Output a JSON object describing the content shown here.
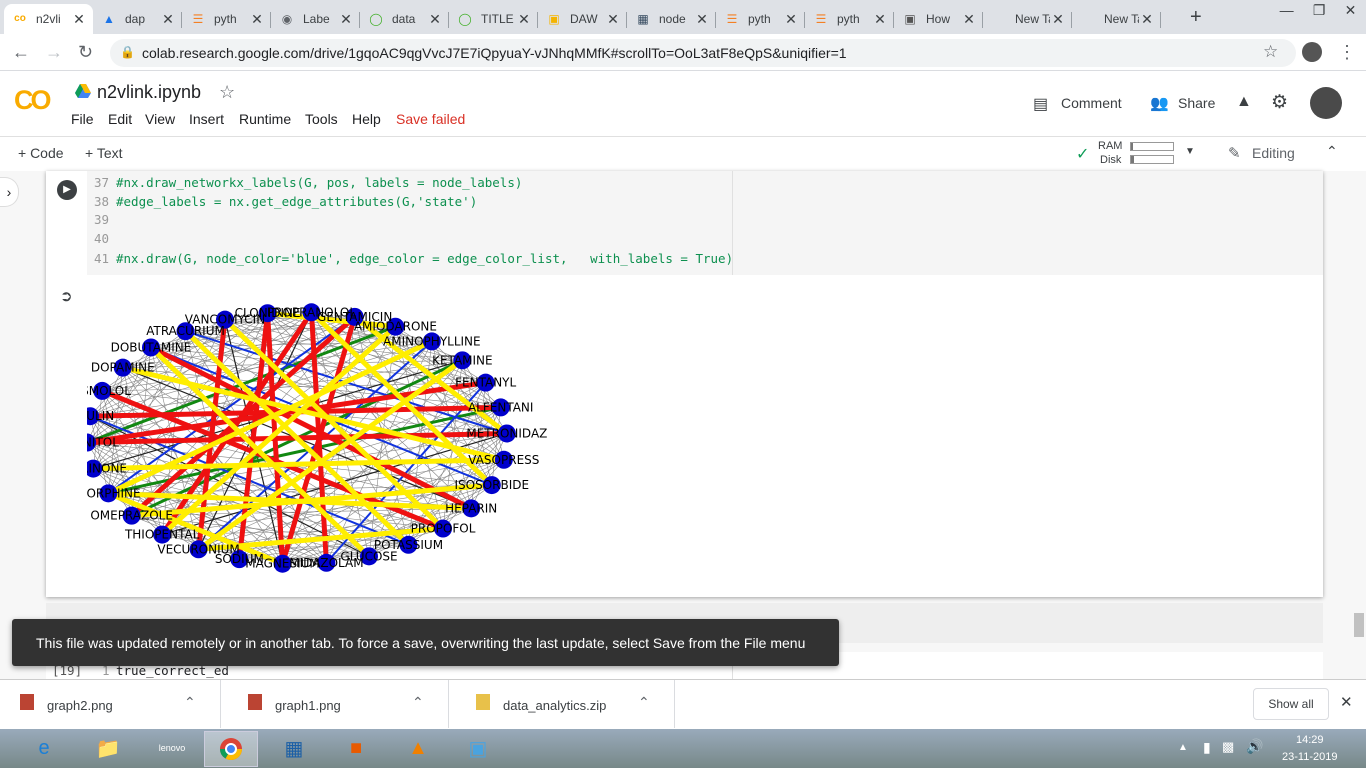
{
  "browser": {
    "tabs": [
      {
        "icon": "colab-icon",
        "label": "n2vli"
      },
      {
        "icon": "drive-icon",
        "label": "dap"
      },
      {
        "icon": "stackoverflow-icon",
        "label": "pyth"
      },
      {
        "icon": "globe-icon",
        "label": "Labe"
      },
      {
        "icon": "anaconda-icon",
        "label": "data"
      },
      {
        "icon": "anaconda-icon",
        "label": "TITLE"
      },
      {
        "icon": "slides-icon",
        "label": "DAW"
      },
      {
        "icon": "page-icon",
        "label": "node"
      },
      {
        "icon": "stackoverflow-icon",
        "label": "pyth"
      },
      {
        "icon": "stackoverflow-icon",
        "label": "pyth"
      },
      {
        "icon": "image-icon",
        "label": "How"
      },
      {
        "icon": "blank-icon",
        "label": "New Tab"
      },
      {
        "icon": "blank-icon",
        "label": "New Tab"
      }
    ],
    "url": "colab.research.google.com/drive/1gqoAC9qgVvcJ7E7iQpyuaY-vJNhqMMfK#scrollTo=OoL3atF8eQpS&uniqifier=1"
  },
  "colab": {
    "logo": "CO",
    "notebook_title": "n2vlink.ipynb",
    "menu": [
      "File",
      "Edit",
      "View",
      "Insert",
      "Runtime",
      "Tools",
      "Help"
    ],
    "save_status": "Save failed",
    "comment_label": "Comment",
    "share_label": "Share",
    "add_code_label": "+ Code",
    "add_text_label": "+ Text",
    "ram_label": "RAM",
    "disk_label": "Disk",
    "editing_label": "Editing"
  },
  "cell": {
    "lines": [
      {
        "num": "37",
        "text": "#nx.draw_networkx_labels(G, pos, labels = node_labels)"
      },
      {
        "num": "38",
        "text": "#edge_labels = nx.get_edge_attributes(G,'state')"
      },
      {
        "num": "39",
        "text": ""
      },
      {
        "num": "40",
        "text": ""
      },
      {
        "num": "41",
        "text": "#nx.draw(G, node_color='blue', edge_color = edge_color_list,   with_labels = True)"
      }
    ],
    "next_cell_count": "[19]",
    "next_cell_lineno": "1",
    "next_cell_code": "true_correct_ed"
  },
  "graph": {
    "colors": {
      "node": "#0000cc",
      "red": "#ee1111",
      "yellow": "#ffee00",
      "blue": "#1133dd",
      "green": "#118811",
      "gray": "#888888",
      "black": "#222222"
    },
    "nodes": [
      "VANCOMYCIN",
      "CLONIDINE",
      "PROPRANOLOL",
      "GENTAMICIN",
      "AMIODARONE",
      "AMINOPHYLLINE",
      "KETAMINE",
      "FENTANYL",
      "ALFENTANIL",
      "METRONIDAZOLE",
      "VASOPRESSIN",
      "ISOSORBIDE",
      "HEPARIN",
      "PROPOFOL",
      "POTASSIUM",
      "GLUCOSE",
      "MIDAZOLAM",
      "MAGNESIUM",
      "SODIUM",
      "VECURONIUM",
      "THIOPENTAL",
      "OMEPRAZOLE",
      "MORPHINE",
      "MILRINONE",
      "MANNITOL",
      "INSULIN",
      "ESMOLOL",
      "DOPAMINE",
      "DOBUTAMINE",
      "ATRACURIUM"
    ],
    "label_text": [
      "VANCOMYCIN",
      "CLONIDINE",
      "PROPRANOLOL",
      "GENTAMICIN",
      "AMIODARONE",
      "AMINOPHYLLINE",
      "KETAMINE",
      "FENTANYL",
      "ALFENTANI",
      "METRONIDAZ",
      "VASOPRESS",
      "ISOSORBIDE",
      "HEPARIN",
      "PROPOFOL",
      "POTASSIUM",
      "GLUCOSE",
      "MIDAZOLAM",
      "MAGNESIUM",
      "SODIUM",
      "VECURONIUM",
      "THIOPENTAL",
      "OMEPRAZOLE",
      "MORPHINE",
      "MILRINONE",
      "MANNITOL",
      "INSULIN",
      "ESMOLOL",
      "DOPAMINE",
      "DOBUTAMINE",
      "ATRACURIUM"
    ]
  },
  "toast": "This file was updated remotely or in another tab. To force a save, overwriting the last update, select Save from the File menu",
  "downloads": {
    "items": [
      "graph2.png",
      "graph1.png",
      "data_analytics.zip"
    ],
    "show_all": "Show all"
  },
  "taskbar": {
    "time": "14:29",
    "date": "23-11-2019"
  }
}
